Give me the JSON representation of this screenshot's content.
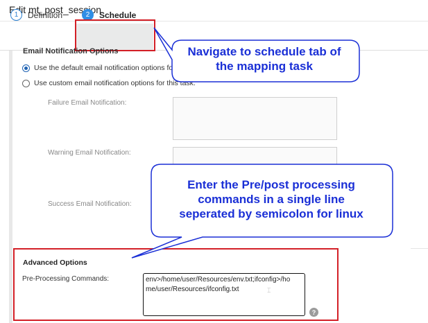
{
  "page": {
    "title": "Edit mt_post_session"
  },
  "tabs": [
    {
      "number": "1",
      "label": "Definition",
      "active": false
    },
    {
      "number": "2",
      "label": "Schedule",
      "active": true
    }
  ],
  "email_section": {
    "heading": "Email Notification Options",
    "options": [
      {
        "label": "Use the default email notification options for",
        "checked": true
      },
      {
        "label": "Use custom email notification options for this task.",
        "checked": false
      }
    ],
    "fields": {
      "failure_label": "Failure Email Notification:",
      "warning_label": "Warning Email Notification:",
      "success_label": "Success Email Notification:"
    }
  },
  "advanced": {
    "title": "Advanced Options",
    "pre_processing_label": "Pre-Processing Commands:",
    "pre_processing_value": "env>/home/user/Resources/env.txt;ifconfig>/home/user/Resources/ifconfig.txt",
    "pre_processing_line1": "env>/home/user/Resources/env.txt;ifconfig>/ho",
    "pre_processing_line2": "me/user/Resources/ifconfig.txt",
    "help_glyph": "?"
  },
  "callouts": {
    "navigate_line1": "Navigate to schedule tab of",
    "navigate_line2": "the mapping task",
    "enter_line1": "Enter the Pre/post processing",
    "enter_line2": "commands in a single line",
    "enter_line3": "seperated by semicolon for linux"
  },
  "colors": {
    "highlight": "#d31f26",
    "callout_text": "#1a2fd6",
    "callout_border": "#1a2fd6",
    "tab_active": "#2f8ee6"
  },
  "icons": {
    "help": "question-circle-icon",
    "radio_checked": "radio-checked-icon",
    "radio_unchecked": "radio-unchecked-icon"
  }
}
